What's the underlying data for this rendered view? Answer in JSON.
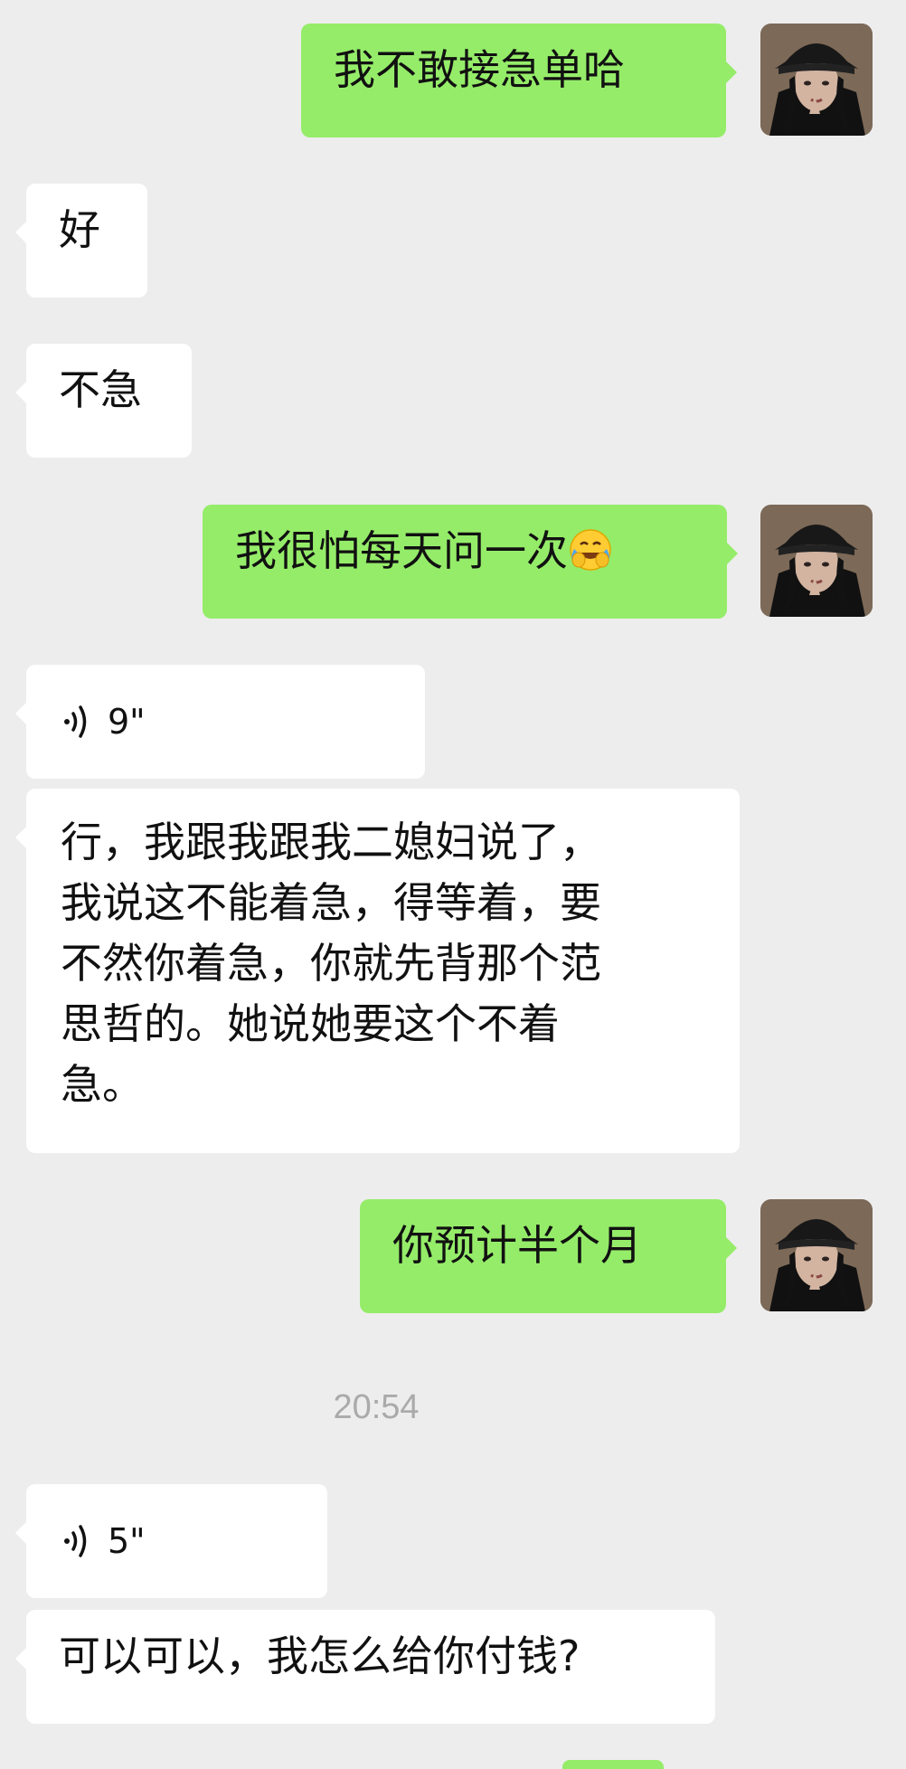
{
  "colors": {
    "background": "#ededed",
    "incoming_bubble": "#ffffff",
    "outgoing_bubble": "#95ec69",
    "timestamp": "#aaaaaa"
  },
  "messages": [
    {
      "direction": "outgoing",
      "text": "我不敢接急单哈"
    },
    {
      "direction": "incoming",
      "text": "好"
    },
    {
      "direction": "incoming",
      "text": "不急"
    },
    {
      "direction": "outgoing",
      "text": "我很怕每天问一次",
      "emoji": "laughing-tears-emoji"
    },
    {
      "direction": "incoming",
      "voice_duration": "9\""
    },
    {
      "direction": "incoming",
      "lines": [
        "行，我跟我跟我二媳妇说了，",
        "我说这不能着急，得等着，要",
        "不然你着急，你就先背那个范",
        "思哲的。她说她要这个不着",
        "急。"
      ]
    },
    {
      "direction": "outgoing",
      "text": "你预计半个月"
    },
    {
      "type": "timestamp",
      "text": "20:54"
    },
    {
      "direction": "incoming",
      "voice_duration": "5\""
    },
    {
      "direction": "incoming",
      "text": "可以可以，我怎么给你付钱?"
    }
  ]
}
